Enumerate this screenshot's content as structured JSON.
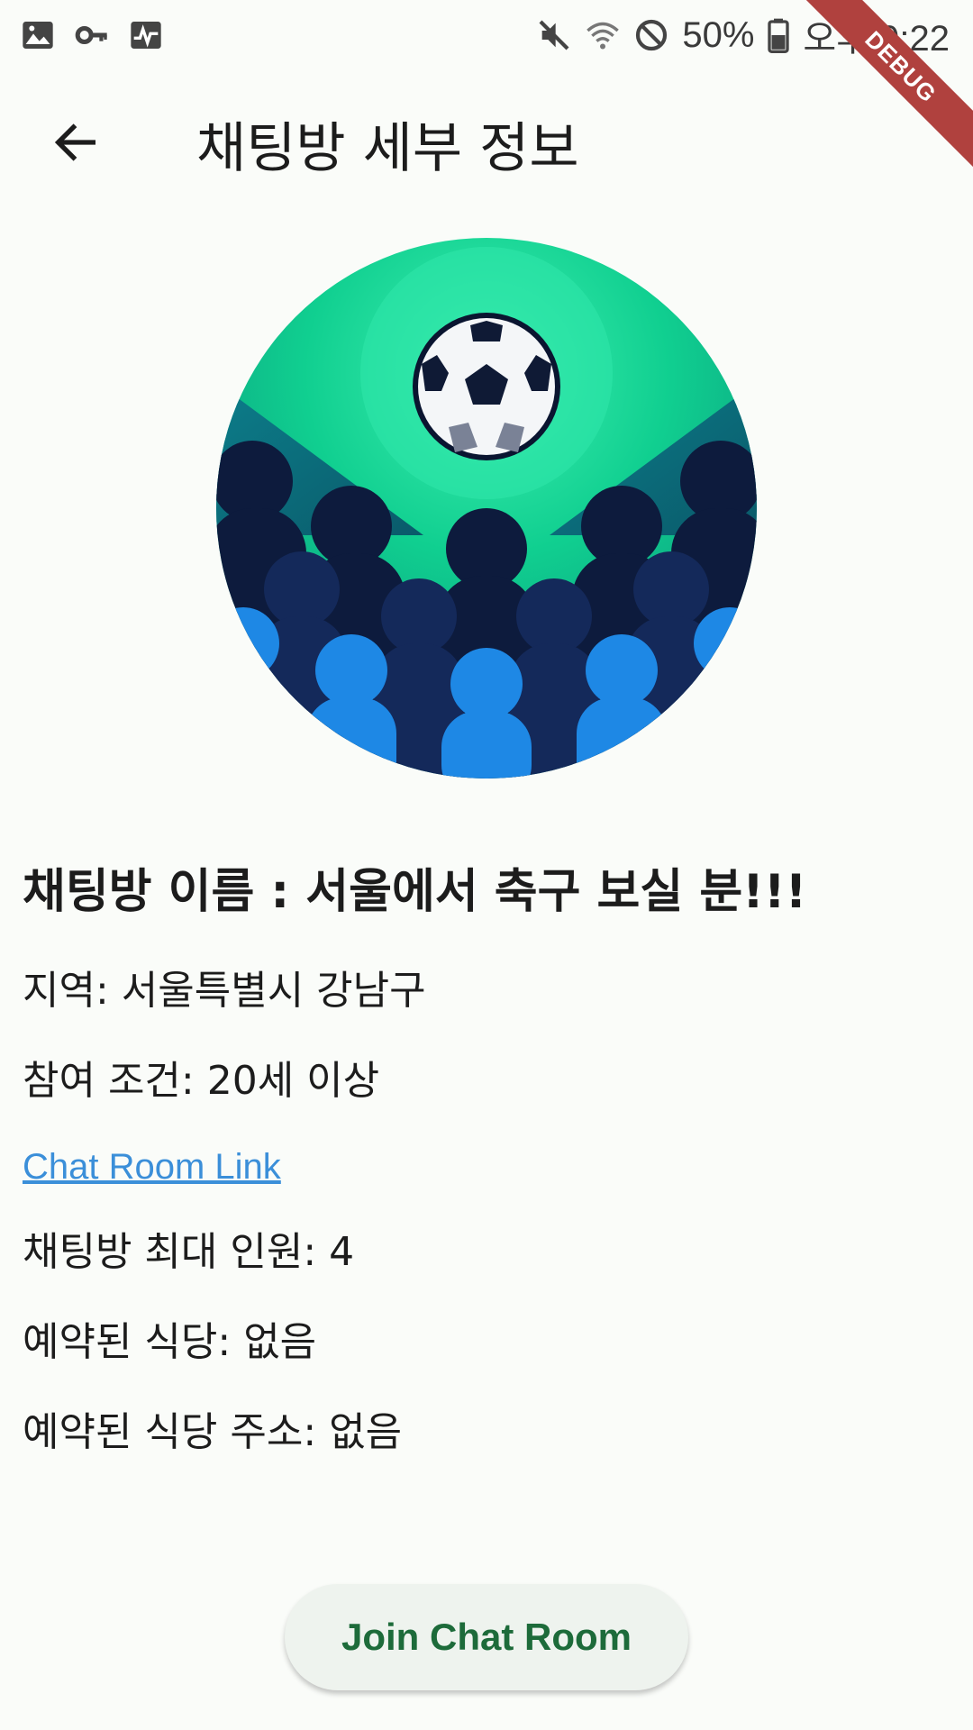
{
  "status_bar": {
    "battery": "50%",
    "time": "오후 9:22",
    "left_icons": [
      "image-icon",
      "key-icon",
      "activity-icon"
    ],
    "right_icons": [
      "mute-icon",
      "wifi-icon",
      "blocked-icon",
      "battery-icon"
    ]
  },
  "debug_ribbon": "DEBUG",
  "app_bar": {
    "title": "채팅방 세부 정보",
    "back_icon": "arrow-back-icon"
  },
  "room": {
    "name": "채팅방 이름 : 서울에서 축구 보실 분!!!",
    "region": "지역: 서울특별시 강남구",
    "condition": "참여 조건: 20세 이상",
    "link_label": "Chat Room Link",
    "max_members": "채팅방 최대 인원: 4",
    "reserved_restaurant": "예약된 식당: 없음",
    "reserved_address": "예약된 식당 주소: 없음"
  },
  "actions": {
    "join_label": "Join Chat Room"
  },
  "colors": {
    "background": "#fafcf9",
    "link": "#3b8fd9",
    "button_text": "#1d6b3a",
    "debug_ribbon": "#b0413e"
  }
}
